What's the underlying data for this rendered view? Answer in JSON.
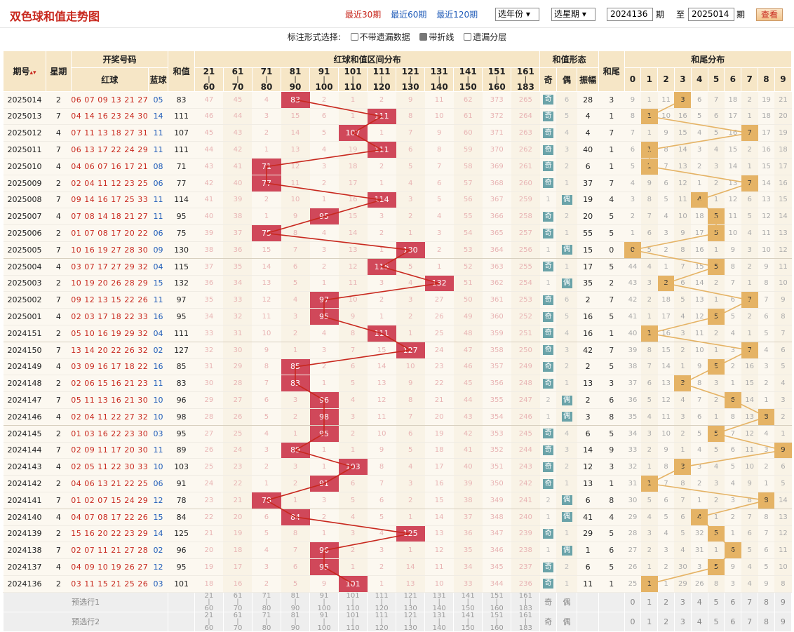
{
  "header": {
    "title": "双色球和值走势图",
    "periods": [
      {
        "label": "最近30期",
        "active": true
      },
      {
        "label": "最近60期",
        "active": false
      },
      {
        "label": "最近120期",
        "active": false
      }
    ],
    "year_select": "选年份",
    "period_select": "选星期",
    "from_issue": "2024136",
    "from_label": "期",
    "to_label": "至",
    "to_issue": "2025014",
    "to_suffix": "期",
    "query_button": "查看"
  },
  "options": {
    "label": "标注形式选择:",
    "items": [
      {
        "label": "不带遗漏数据",
        "checked": false
      },
      {
        "label": "带折线",
        "checked": true
      },
      {
        "label": "遗漏分层",
        "checked": false
      }
    ]
  },
  "table": {
    "col_issue": "期号",
    "col_weekday": "星期",
    "col_draw": "开奖号码",
    "col_red": "红球",
    "col_blue": "蓝球",
    "col_sum": "和值",
    "col_dist": "红球和值区间分布",
    "ranges": [
      [
        "21",
        "60"
      ],
      [
        "61",
        "70"
      ],
      [
        "71",
        "80"
      ],
      [
        "81",
        "90"
      ],
      [
        "91",
        "100"
      ],
      [
        "101",
        "110"
      ],
      [
        "111",
        "120"
      ],
      [
        "121",
        "130"
      ],
      [
        "131",
        "140"
      ],
      [
        "141",
        "150"
      ],
      [
        "151",
        "160"
      ],
      [
        "161",
        "183"
      ]
    ],
    "col_form": "和值形态",
    "form_heads": [
      "奇",
      "偶",
      "振幅"
    ],
    "col_tail": "和尾",
    "col_taildist": "和尾分布",
    "tail_heads": [
      "0",
      "1",
      "2",
      "3",
      "4",
      "5",
      "6",
      "7",
      "8",
      "9"
    ],
    "sort_arrow": "▴▾"
  },
  "rows": [
    {
      "issue": "2025014",
      "wd": "2",
      "red": "06 07 09 13 21 27",
      "blue": "05",
      "sum": "83",
      "dist": [
        "47",
        "45",
        "4",
        "83",
        "2",
        "1",
        "2",
        "9",
        "11",
        "62",
        "373",
        "265"
      ],
      "odd": true,
      "oe_miss": "6",
      "amp": "28",
      "tail": "3",
      "tails": [
        "9",
        "1",
        "11",
        "3",
        "6",
        "7",
        "18",
        "2",
        "19",
        "21"
      ]
    },
    {
      "issue": "2025013",
      "wd": "7",
      "red": "04 14 16 23 24 30",
      "blue": "14",
      "sum": "111",
      "dist": [
        "46",
        "44",
        "3",
        "15",
        "6",
        "1",
        "111",
        "8",
        "10",
        "61",
        "372",
        "264"
      ],
      "odd": true,
      "oe_miss": "5",
      "amp": "4",
      "tail": "1",
      "tails": [
        "8",
        "1",
        "10",
        "16",
        "5",
        "6",
        "17",
        "1",
        "18",
        "20"
      ]
    },
    {
      "issue": "2025012",
      "wd": "4",
      "red": "07 11 13 18 27 31",
      "blue": "11",
      "sum": "107",
      "dist": [
        "45",
        "43",
        "2",
        "14",
        "5",
        "107",
        "1",
        "7",
        "9",
        "60",
        "371",
        "263"
      ],
      "odd": true,
      "oe_miss": "4",
      "amp": "4",
      "tail": "7",
      "tails": [
        "7",
        "1",
        "9",
        "15",
        "4",
        "5",
        "16",
        "7",
        "17",
        "19"
      ]
    },
    {
      "issue": "2025011",
      "wd": "7",
      "red": "06 13 17 22 24 29",
      "blue": "11",
      "sum": "111",
      "dist": [
        "44",
        "42",
        "1",
        "13",
        "4",
        "19",
        "111",
        "6",
        "8",
        "59",
        "370",
        "262"
      ],
      "odd": true,
      "oe_miss": "3",
      "amp": "40",
      "tail": "1",
      "tails": [
        "6",
        "1",
        "8",
        "14",
        "3",
        "4",
        "15",
        "2",
        "16",
        "18"
      ]
    },
    {
      "issue": "2025010",
      "wd": "4",
      "red": "04 06 07 16 17 21",
      "blue": "08",
      "sum": "71",
      "dist": [
        "43",
        "41",
        "71",
        "12",
        "3",
        "18",
        "2",
        "5",
        "7",
        "58",
        "369",
        "261"
      ],
      "odd": true,
      "oe_miss": "2",
      "amp": "6",
      "tail": "1",
      "tails": [
        "5",
        "1",
        "7",
        "13",
        "2",
        "3",
        "14",
        "1",
        "15",
        "17"
      ]
    },
    {
      "issue": "2025009",
      "wd": "2",
      "red": "02 04 11 12 23 25",
      "blue": "06",
      "sum": "77",
      "dist": [
        "42",
        "40",
        "77",
        "11",
        "2",
        "17",
        "1",
        "4",
        "6",
        "57",
        "368",
        "260"
      ],
      "odd": true,
      "oe_miss": "1",
      "amp": "37",
      "tail": "7",
      "tails": [
        "4",
        "9",
        "6",
        "12",
        "1",
        "2",
        "13",
        "7",
        "14",
        "16"
      ]
    },
    {
      "issue": "2025008",
      "wd": "7",
      "red": "09 14 16 17 25 33",
      "blue": "11",
      "sum": "114",
      "dist": [
        "41",
        "39",
        "2",
        "10",
        "1",
        "16",
        "114",
        "3",
        "5",
        "56",
        "367",
        "259"
      ],
      "odd": false,
      "oe_miss": "1",
      "amp": "19",
      "tail": "4",
      "tails": [
        "3",
        "8",
        "5",
        "11",
        "4",
        "1",
        "12",
        "6",
        "13",
        "15"
      ]
    },
    {
      "issue": "2025007",
      "wd": "4",
      "red": "07 08 14 18 21 27",
      "blue": "11",
      "sum": "95",
      "dist": [
        "40",
        "38",
        "1",
        "9",
        "95",
        "15",
        "3",
        "2",
        "4",
        "55",
        "366",
        "258"
      ],
      "odd": true,
      "oe_miss": "2",
      "amp": "20",
      "tail": "5",
      "tails": [
        "2",
        "7",
        "4",
        "10",
        "18",
        "5",
        "11",
        "5",
        "12",
        "14"
      ]
    },
    {
      "issue": "2025006",
      "wd": "2",
      "red": "01 07 08 17 20 22",
      "blue": "06",
      "sum": "75",
      "dist": [
        "39",
        "37",
        "75",
        "8",
        "4",
        "14",
        "2",
        "1",
        "3",
        "54",
        "365",
        "257"
      ],
      "odd": true,
      "oe_miss": "1",
      "amp": "55",
      "tail": "5",
      "tails": [
        "1",
        "6",
        "3",
        "9",
        "17",
        "5",
        "10",
        "4",
        "11",
        "13"
      ]
    },
    {
      "issue": "2025005",
      "wd": "7",
      "red": "10 16 19 27 28 30",
      "blue": "09",
      "sum": "130",
      "dist": [
        "38",
        "36",
        "15",
        "7",
        "3",
        "13",
        "1",
        "130",
        "2",
        "53",
        "364",
        "256"
      ],
      "odd": false,
      "oe_miss": "1",
      "amp": "15",
      "tail": "0",
      "tails": [
        "0",
        "5",
        "2",
        "8",
        "16",
        "1",
        "9",
        "3",
        "10",
        "12"
      ]
    },
    {
      "issue": "2025004",
      "wd": "4",
      "red": "03 07 17 27 29 32",
      "blue": "04",
      "sum": "115",
      "dist": [
        "37",
        "35",
        "14",
        "6",
        "2",
        "12",
        "115",
        "5",
        "1",
        "52",
        "363",
        "255"
      ],
      "odd": true,
      "oe_miss": "1",
      "amp": "17",
      "tail": "5",
      "tails": [
        "44",
        "4",
        "1",
        "7",
        "15",
        "5",
        "8",
        "2",
        "9",
        "11"
      ]
    },
    {
      "issue": "2025003",
      "wd": "2",
      "red": "10 19 20 26 28 29",
      "blue": "15",
      "sum": "132",
      "dist": [
        "36",
        "34",
        "13",
        "5",
        "1",
        "11",
        "3",
        "4",
        "132",
        "51",
        "362",
        "254"
      ],
      "odd": false,
      "oe_miss": "1",
      "amp": "35",
      "tail": "2",
      "tails": [
        "43",
        "3",
        "2",
        "6",
        "14",
        "2",
        "7",
        "1",
        "8",
        "10"
      ]
    },
    {
      "issue": "2025002",
      "wd": "7",
      "red": "09 12 13 15 22 26",
      "blue": "11",
      "sum": "97",
      "dist": [
        "35",
        "33",
        "12",
        "4",
        "97",
        "10",
        "2",
        "3",
        "27",
        "50",
        "361",
        "253"
      ],
      "odd": true,
      "oe_miss": "6",
      "amp": "2",
      "tail": "7",
      "tails": [
        "42",
        "2",
        "18",
        "5",
        "13",
        "1",
        "6",
        "7",
        "7",
        "9"
      ]
    },
    {
      "issue": "2025001",
      "wd": "4",
      "red": "02 03 17 18 22 33",
      "blue": "16",
      "sum": "95",
      "dist": [
        "34",
        "32",
        "11",
        "3",
        "95",
        "9",
        "1",
        "2",
        "26",
        "49",
        "360",
        "252"
      ],
      "odd": true,
      "oe_miss": "5",
      "amp": "16",
      "tail": "5",
      "tails": [
        "41",
        "1",
        "17",
        "4",
        "12",
        "5",
        "5",
        "2",
        "6",
        "8"
      ]
    },
    {
      "issue": "2024151",
      "wd": "2",
      "red": "05 10 16 19 29 32",
      "blue": "04",
      "sum": "111",
      "dist": [
        "33",
        "31",
        "10",
        "2",
        "4",
        "8",
        "111",
        "1",
        "25",
        "48",
        "359",
        "251"
      ],
      "odd": true,
      "oe_miss": "4",
      "amp": "16",
      "tail": "1",
      "tails": [
        "40",
        "1",
        "16",
        "3",
        "11",
        "2",
        "4",
        "1",
        "5",
        "7"
      ]
    },
    {
      "issue": "2024150",
      "wd": "7",
      "red": "13 14 20 22 26 32",
      "blue": "02",
      "sum": "127",
      "dist": [
        "32",
        "30",
        "9",
        "1",
        "3",
        "7",
        "15",
        "127",
        "24",
        "47",
        "358",
        "250"
      ],
      "odd": true,
      "oe_miss": "3",
      "amp": "42",
      "tail": "7",
      "tails": [
        "39",
        "8",
        "15",
        "2",
        "10",
        "1",
        "3",
        "7",
        "4",
        "6"
      ]
    },
    {
      "issue": "2024149",
      "wd": "4",
      "red": "03 09 16 17 18 22",
      "blue": "16",
      "sum": "85",
      "dist": [
        "31",
        "29",
        "8",
        "85",
        "2",
        "6",
        "14",
        "10",
        "23",
        "46",
        "357",
        "249"
      ],
      "odd": true,
      "oe_miss": "2",
      "amp": "2",
      "tail": "5",
      "tails": [
        "38",
        "7",
        "14",
        "1",
        "9",
        "5",
        "2",
        "16",
        "3",
        "5"
      ]
    },
    {
      "issue": "2024148",
      "wd": "2",
      "red": "02 06 15 16 21 23",
      "blue": "11",
      "sum": "83",
      "dist": [
        "30",
        "28",
        "7",
        "83",
        "1",
        "5",
        "13",
        "9",
        "22",
        "45",
        "356",
        "248"
      ],
      "odd": true,
      "oe_miss": "1",
      "amp": "13",
      "tail": "3",
      "tails": [
        "37",
        "6",
        "13",
        "3",
        "8",
        "3",
        "1",
        "15",
        "2",
        "4"
      ]
    },
    {
      "issue": "2024147",
      "wd": "7",
      "red": "05 11 13 16 21 30",
      "blue": "10",
      "sum": "96",
      "dist": [
        "29",
        "27",
        "6",
        "3",
        "96",
        "4",
        "12",
        "8",
        "21",
        "44",
        "355",
        "247"
      ],
      "odd": false,
      "oe_miss": "2",
      "amp": "2",
      "tail": "6",
      "tails": [
        "36",
        "5",
        "12",
        "4",
        "7",
        "2",
        "6",
        "14",
        "1",
        "3"
      ]
    },
    {
      "issue": "2024146",
      "wd": "4",
      "red": "02 04 11 22 27 32",
      "blue": "10",
      "sum": "98",
      "dist": [
        "28",
        "26",
        "5",
        "2",
        "98",
        "3",
        "11",
        "7",
        "20",
        "43",
        "354",
        "246"
      ],
      "odd": false,
      "oe_miss": "1",
      "amp": "3",
      "tail": "8",
      "tails": [
        "35",
        "4",
        "11",
        "3",
        "6",
        "1",
        "8",
        "13",
        "8",
        "2"
      ]
    },
    {
      "issue": "2024145",
      "wd": "2",
      "red": "01 03 16 22 23 30",
      "blue": "03",
      "sum": "95",
      "dist": [
        "27",
        "25",
        "4",
        "1",
        "95",
        "2",
        "10",
        "6",
        "19",
        "42",
        "353",
        "245"
      ],
      "odd": true,
      "oe_miss": "4",
      "amp": "6",
      "tail": "5",
      "tails": [
        "34",
        "3",
        "10",
        "2",
        "5",
        "5",
        "7",
        "12",
        "4",
        "1"
      ]
    },
    {
      "issue": "2024144",
      "wd": "7",
      "red": "02 09 11 17 20 30",
      "blue": "11",
      "sum": "89",
      "dist": [
        "26",
        "24",
        "3",
        "89",
        "1",
        "1",
        "9",
        "5",
        "18",
        "41",
        "352",
        "244"
      ],
      "odd": true,
      "oe_miss": "3",
      "amp": "14",
      "tail": "9",
      "tails": [
        "33",
        "2",
        "9",
        "1",
        "4",
        "5",
        "6",
        "11",
        "3",
        "9"
      ]
    },
    {
      "issue": "2024143",
      "wd": "4",
      "red": "02 05 11 22 30 33",
      "blue": "10",
      "sum": "103",
      "dist": [
        "25",
        "23",
        "2",
        "3",
        "1",
        "103",
        "8",
        "4",
        "17",
        "40",
        "351",
        "243"
      ],
      "odd": true,
      "oe_miss": "2",
      "amp": "12",
      "tail": "3",
      "tails": [
        "32",
        "1",
        "8",
        "3",
        "3",
        "4",
        "5",
        "10",
        "2",
        "6"
      ]
    },
    {
      "issue": "2024142",
      "wd": "2",
      "red": "04 06 13 21 22 25",
      "blue": "06",
      "sum": "91",
      "dist": [
        "24",
        "22",
        "1",
        "2",
        "91",
        "6",
        "7",
        "3",
        "16",
        "39",
        "350",
        "242"
      ],
      "odd": true,
      "oe_miss": "1",
      "amp": "13",
      "tail": "1",
      "tails": [
        "31",
        "1",
        "7",
        "8",
        "2",
        "3",
        "4",
        "9",
        "1",
        "5"
      ]
    },
    {
      "issue": "2024141",
      "wd": "7",
      "red": "01 02 07 15 24 29",
      "blue": "12",
      "sum": "78",
      "dist": [
        "23",
        "21",
        "78",
        "1",
        "3",
        "5",
        "6",
        "2",
        "15",
        "38",
        "349",
        "241"
      ],
      "odd": false,
      "oe_miss": "2",
      "amp": "6",
      "tail": "8",
      "tails": [
        "30",
        "5",
        "6",
        "7",
        "1",
        "2",
        "3",
        "8",
        "8",
        "14"
      ]
    },
    {
      "issue": "2024140",
      "wd": "4",
      "red": "04 07 08 17 22 26",
      "blue": "15",
      "sum": "84",
      "dist": [
        "22",
        "20",
        "6",
        "84",
        "2",
        "4",
        "5",
        "1",
        "14",
        "37",
        "348",
        "240"
      ],
      "odd": false,
      "oe_miss": "1",
      "amp": "41",
      "tail": "4",
      "tails": [
        "29",
        "4",
        "5",
        "6",
        "4",
        "1",
        "2",
        "7",
        "8",
        "13"
      ]
    },
    {
      "issue": "2024139",
      "wd": "2",
      "red": "15 16 20 22 23 29",
      "blue": "14",
      "sum": "125",
      "dist": [
        "21",
        "19",
        "5",
        "8",
        "1",
        "3",
        "4",
        "125",
        "13",
        "36",
        "347",
        "239"
      ],
      "odd": true,
      "oe_miss": "1",
      "amp": "29",
      "tail": "5",
      "tails": [
        "28",
        "3",
        "4",
        "5",
        "32",
        "5",
        "1",
        "6",
        "7",
        "12"
      ]
    },
    {
      "issue": "2024138",
      "wd": "7",
      "red": "02 07 11 21 27 28",
      "blue": "02",
      "sum": "96",
      "dist": [
        "20",
        "18",
        "4",
        "7",
        "96",
        "2",
        "3",
        "1",
        "12",
        "35",
        "346",
        "238"
      ],
      "odd": false,
      "oe_miss": "1",
      "amp": "1",
      "tail": "6",
      "tails": [
        "27",
        "2",
        "3",
        "4",
        "31",
        "1",
        "6",
        "5",
        "6",
        "11"
      ]
    },
    {
      "issue": "2024137",
      "wd": "4",
      "red": "04 09 10 19 26 27",
      "blue": "12",
      "sum": "95",
      "dist": [
        "19",
        "17",
        "3",
        "6",
        "95",
        "1",
        "2",
        "14",
        "11",
        "34",
        "345",
        "237"
      ],
      "odd": true,
      "oe_miss": "2",
      "amp": "6",
      "tail": "5",
      "tails": [
        "26",
        "1",
        "2",
        "30",
        "3",
        "5",
        "9",
        "4",
        "5",
        "10"
      ]
    },
    {
      "issue": "2024136",
      "wd": "2",
      "red": "03 11 15 21 25 26",
      "blue": "03",
      "sum": "101",
      "dist": [
        "18",
        "16",
        "2",
        "5",
        "9",
        "101",
        "1",
        "13",
        "10",
        "33",
        "344",
        "236"
      ],
      "odd": true,
      "oe_miss": "1",
      "amp": "11",
      "tail": "1",
      "tails": [
        "25",
        "1",
        "1",
        "29",
        "26",
        "8",
        "3",
        "4",
        "9",
        "8"
      ]
    }
  ],
  "footer": {
    "row1": "预选行1",
    "row2": "预选行2",
    "odd": "奇",
    "even": "偶"
  },
  "colors": {
    "hit_red": "#d0485a",
    "hit_tail": "#e5b365",
    "header_bg": "#f6e6c6",
    "odd_tag": "#6aa3a9",
    "line_red": "#c8281e",
    "line_tail": "#e5b365"
  }
}
